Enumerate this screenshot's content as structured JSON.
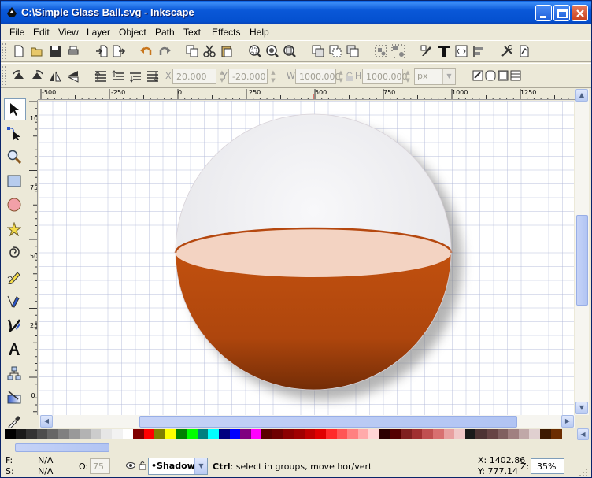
{
  "window": {
    "title": "C:\\Simple Glass Ball.svg - Inkscape"
  },
  "menubar": {
    "items": [
      {
        "label": "File"
      },
      {
        "label": "Edit"
      },
      {
        "label": "View"
      },
      {
        "label": "Layer"
      },
      {
        "label": "Object"
      },
      {
        "label": "Path"
      },
      {
        "label": "Text"
      },
      {
        "label": "Effects"
      },
      {
        "label": "Help"
      }
    ]
  },
  "controls": {
    "x": {
      "label": "X",
      "value": "20.000"
    },
    "y": {
      "label": "Y",
      "value": "-20.000"
    },
    "w": {
      "label": "W",
      "value": "1000.000"
    },
    "h": {
      "label": "H",
      "value": "1000.000"
    },
    "unit": "px"
  },
  "ruler": {
    "horizontal": [
      "-500",
      "-250",
      "0",
      "250",
      "500",
      "750",
      "1000",
      "1250"
    ],
    "vertical": [
      "1000",
      "750",
      "500",
      "250",
      "0"
    ]
  },
  "palette": {
    "colors": [
      "#000000",
      "#1a1a1a",
      "#333333",
      "#4d4d4d",
      "#666666",
      "#808080",
      "#999999",
      "#b3b3b3",
      "#cccccc",
      "#e6e6e6",
      "#f2f2f2",
      "#ffffff",
      "#800000",
      "#ff0000",
      "#808000",
      "#ffff00",
      "#008000",
      "#00ff00",
      "#008080",
      "#00ffff",
      "#000080",
      "#0000ff",
      "#800080",
      "#ff00ff",
      "#5a0000",
      "#6e0000",
      "#8c0000",
      "#a00000",
      "#c00000",
      "#e00000",
      "#ff2a2a",
      "#ff5555",
      "#ff8080",
      "#ffaaaa",
      "#ffd5d5",
      "#2b0000",
      "#550000",
      "#802020",
      "#a03030",
      "#c05050",
      "#d87070",
      "#e8a0a0",
      "#f0c8c8",
      "#1a1a1a",
      "#4d3333",
      "#664444",
      "#806060",
      "#a08080",
      "#c0a8a8",
      "#e0d0d0",
      "#3d1a00",
      "#6b2d00"
    ]
  },
  "status": {
    "fill_label": "F:",
    "fill_value": "N/A",
    "stroke_label": "S:",
    "stroke_value": "N/A",
    "opacity_label": "O:",
    "opacity_value": "75",
    "layer": "•Shadow",
    "message_key": "Ctrl",
    "message": ": select in groups, move hor/vert",
    "cursor_x": "X: 1402.86",
    "cursor_y": "Y:  777.14",
    "zoom_label": "Z:",
    "zoom": "35%"
  },
  "colors": {
    "accent": "#0A58D8",
    "ball_liquid": "#B84A0E",
    "ball_liquid_dark": "#7E2E06",
    "liquid_surface": "#F3D3C2",
    "glass": "#EEEEF0"
  }
}
